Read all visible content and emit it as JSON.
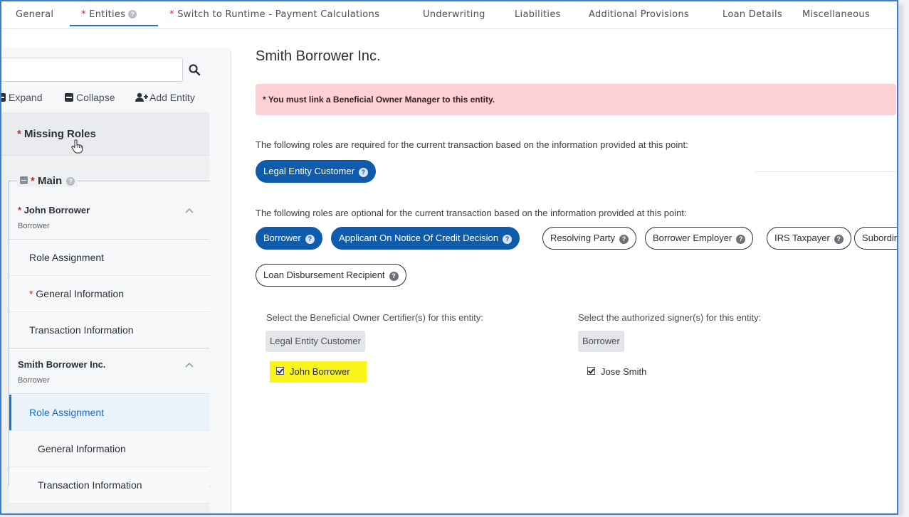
{
  "nav": {
    "tabs": [
      {
        "label": "General",
        "required": false
      },
      {
        "label": "Entities",
        "required": true
      },
      {
        "label": "Switch to Runtime - Payment Calculations",
        "required": true
      },
      {
        "label": "Underwriting",
        "required": false
      },
      {
        "label": "Liabilities",
        "required": false
      },
      {
        "label": "Additional Provisions",
        "required": false
      },
      {
        "label": "Loan Details",
        "required": false
      },
      {
        "label": "Miscellaneous",
        "required": false
      }
    ],
    "active_tab": "Entities",
    "req_marker": "*"
  },
  "sidebar": {
    "search": {
      "value": "",
      "placeholder": ""
    },
    "toolbar": {
      "expand": "Expand",
      "collapse": "Collapse",
      "add_entity": "Add Entity"
    },
    "missing_roles": "Missing Roles",
    "group": "Main",
    "entities": [
      {
        "name": "John Borrower",
        "role": "Borrower",
        "required": true,
        "items": [
          {
            "label": "Role Assignment",
            "required": false
          },
          {
            "label": "General Information",
            "required": true
          },
          {
            "label": "Transaction Information",
            "required": false
          }
        ]
      },
      {
        "name": "Smith Borrower Inc.",
        "role": "Borrower",
        "required": false,
        "items": [
          {
            "label": "Role Assignment",
            "required": false,
            "active": true
          },
          {
            "label": "General Information",
            "required": false
          },
          {
            "label": "Transaction Information",
            "required": false
          }
        ]
      }
    ]
  },
  "main": {
    "title": "Smith Borrower Inc.",
    "alert": "* You must link a Beneficial Owner Manager to this entity.",
    "required_text": "The following roles are required for the current transaction based on the information provided at this point:",
    "required_roles": [
      "Legal Entity Customer"
    ],
    "optional_text": "The following roles are optional for the current transaction based on the information provided at this point:",
    "optional_roles": [
      {
        "label": "Borrower",
        "selected": true
      },
      {
        "label": "Applicant On Notice Of Credit Decision",
        "selected": true
      },
      {
        "label": "Resolving Party",
        "selected": false
      },
      {
        "label": "Borrower Employer",
        "selected": false
      },
      {
        "label": "IRS Taxpayer",
        "selected": false
      },
      {
        "label": "Subordin",
        "selected": false
      },
      {
        "label": "Loan Disbursement Recipient",
        "selected": false
      }
    ],
    "certifier": {
      "label": "Select the Beneficial Owner Certifier(s) for this entity:",
      "tag": "Legal Entity Customer",
      "option": "John Borrower",
      "checked": true
    },
    "signer": {
      "label": "Select the authorized signer(s) for this entity:",
      "tag": "Borrower",
      "option": "Jose Smith",
      "checked": true
    }
  },
  "colors": {
    "accent": "#1a75d2",
    "pill": "#0f5cad",
    "alert_bg": "#fdd1d3",
    "required": "#d2202a",
    "highlight": "#fbf41a"
  }
}
